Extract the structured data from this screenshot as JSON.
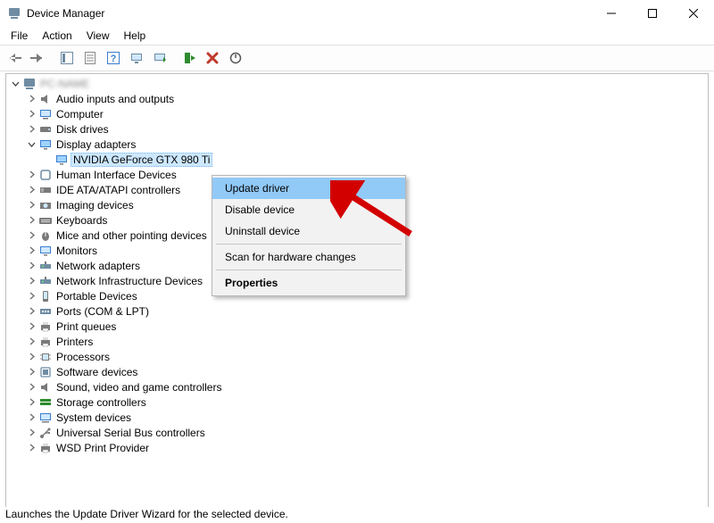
{
  "window": {
    "title": "Device Manager"
  },
  "menubar": {
    "items": [
      "File",
      "Action",
      "View",
      "Help"
    ]
  },
  "tree": {
    "root_label": "PC-NAME",
    "categories": [
      {
        "label": "Audio inputs and outputs",
        "icon": "audio",
        "expanded": false
      },
      {
        "label": "Computer",
        "icon": "computer",
        "expanded": false
      },
      {
        "label": "Disk drives",
        "icon": "disk",
        "expanded": false
      },
      {
        "label": "Display adapters",
        "icon": "display",
        "expanded": true,
        "children": [
          {
            "label": "NVIDIA GeForce GTX 980 Ti",
            "icon": "display",
            "selected": true
          }
        ]
      },
      {
        "label": "Human Interface Devices",
        "icon": "hid",
        "expanded": false
      },
      {
        "label": "IDE ATA/ATAPI controllers",
        "icon": "ide",
        "expanded": false
      },
      {
        "label": "Imaging devices",
        "icon": "imaging",
        "expanded": false
      },
      {
        "label": "Keyboards",
        "icon": "keyboard",
        "expanded": false
      },
      {
        "label": "Mice and other pointing devices",
        "icon": "mouse",
        "expanded": false
      },
      {
        "label": "Monitors",
        "icon": "monitor",
        "expanded": false
      },
      {
        "label": "Network adapters",
        "icon": "network",
        "expanded": false
      },
      {
        "label": "Network Infrastructure Devices",
        "icon": "network",
        "expanded": false
      },
      {
        "label": "Portable Devices",
        "icon": "portable",
        "expanded": false
      },
      {
        "label": "Ports (COM & LPT)",
        "icon": "port",
        "expanded": false
      },
      {
        "label": "Print queues",
        "icon": "printer",
        "expanded": false
      },
      {
        "label": "Printers",
        "icon": "printer",
        "expanded": false
      },
      {
        "label": "Processors",
        "icon": "cpu",
        "expanded": false
      },
      {
        "label": "Software devices",
        "icon": "software",
        "expanded": false
      },
      {
        "label": "Sound, video and game controllers",
        "icon": "audio",
        "expanded": false
      },
      {
        "label": "Storage controllers",
        "icon": "storage",
        "expanded": false
      },
      {
        "label": "System devices",
        "icon": "system",
        "expanded": false
      },
      {
        "label": "Universal Serial Bus controllers",
        "icon": "usb",
        "expanded": false
      },
      {
        "label": "WSD Print Provider",
        "icon": "printer",
        "expanded": false
      }
    ]
  },
  "context_menu": {
    "items": [
      {
        "label": "Update driver",
        "highlight": true
      },
      {
        "label": "Disable device"
      },
      {
        "label": "Uninstall device"
      },
      {
        "separator": true
      },
      {
        "label": "Scan for hardware changes"
      },
      {
        "separator": true
      },
      {
        "label": "Properties",
        "bold": true
      }
    ]
  },
  "statusbar": {
    "text": "Launches the Update Driver Wizard for the selected device."
  }
}
